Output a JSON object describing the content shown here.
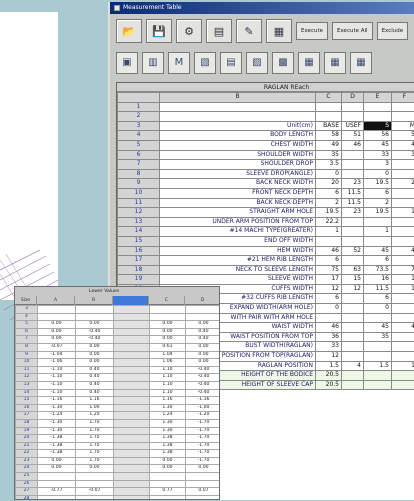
{
  "window": {
    "title": "Measurement Table"
  },
  "toolbar": {
    "icons": [
      "open-icon",
      "save-icon",
      "tools-icon",
      "chart-icon",
      "edit-icon",
      "grid-icon"
    ],
    "buttons": [
      "Execute",
      "Execute All",
      "Exclude"
    ]
  },
  "toolbar2": {
    "icons": [
      "table-layout-icon",
      "columns-icon",
      "m-icon",
      "split-icon",
      "sheet-icon",
      "insert-col-icon",
      "insert-row-icon",
      "merge-icon",
      "merge-right-icon",
      "grid-end-icon"
    ],
    "m_label": "M"
  },
  "sheet": {
    "title": "RAGLAN REach",
    "columns": [
      "B",
      "C",
      "D",
      "E",
      "F"
    ],
    "units_row": {
      "label": "Unit(cm)",
      "values": [
        "BASE",
        "USEF",
        "S",
        "M"
      ]
    },
    "rows": [
      {
        "n": "1",
        "label": "",
        "values": [
          "",
          "",
          "",
          ""
        ]
      },
      {
        "n": "2",
        "label": "",
        "values": [
          "",
          "",
          "",
          ""
        ]
      },
      {
        "n": "3",
        "label": "Unit(cm)",
        "values": [
          "BASE",
          "USEF",
          "S",
          "M"
        ],
        "units": true
      },
      {
        "n": "4",
        "label": "BODY LENGTH",
        "values": [
          "58",
          "51",
          "56",
          "5"
        ]
      },
      {
        "n": "5",
        "label": "CHEST WIDTH",
        "values": [
          "49",
          "46",
          "45",
          "4"
        ]
      },
      {
        "n": "6",
        "label": "SHOULDER WIDTH",
        "values": [
          "35",
          "",
          "33",
          "3"
        ]
      },
      {
        "n": "7",
        "label": "SHOULDER DROP",
        "values": [
          "3.5",
          "",
          "3",
          ""
        ]
      },
      {
        "n": "8",
        "label": "SLEEVE DROP(ANGLE)",
        "values": [
          "0",
          "",
          "0",
          ""
        ]
      },
      {
        "n": "9",
        "label": "BACK NECK WIDTH",
        "values": [
          "20",
          "23",
          "19.5",
          "2"
        ]
      },
      {
        "n": "10",
        "label": "FRONT NECK DEPTH",
        "values": [
          "6",
          "11.5",
          "6",
          ""
        ]
      },
      {
        "n": "11",
        "label": "BACK NECK DEPTH",
        "values": [
          "2",
          "11.5",
          "2",
          ""
        ]
      },
      {
        "n": "12",
        "label": "STRAIGHT ARM HOLE",
        "values": [
          "19.5",
          "23",
          "19.5",
          "1"
        ]
      },
      {
        "n": "13",
        "label": "UNDER ARM POSITION FROM TOP",
        "values": [
          "22.2",
          "",
          "",
          ""
        ]
      },
      {
        "n": "14",
        "label": "#14 MACHI TYPE(GREATER)",
        "values": [
          "1",
          "",
          "1",
          ""
        ]
      },
      {
        "n": "15",
        "label": "END OFF WIDTH",
        "values": [
          "",
          "",
          "",
          ""
        ]
      },
      {
        "n": "16",
        "label": "HEM WIDTH",
        "values": [
          "46",
          "52",
          "45",
          "4"
        ]
      },
      {
        "n": "17",
        "label": "#21 HEM RIB LENGTH",
        "values": [
          "6",
          "",
          "6",
          ""
        ]
      },
      {
        "n": "18",
        "label": "NECK TO SLEEVE LENGTH",
        "values": [
          "75",
          "63",
          "73.5",
          "7"
        ]
      },
      {
        "n": "19",
        "label": "SLEEVE WIDTH",
        "values": [
          "17",
          "15",
          "16",
          "1"
        ]
      },
      {
        "n": "20",
        "label": "CUFFS WIDTH",
        "values": [
          "12",
          "12",
          "11.5",
          "1"
        ]
      },
      {
        "n": "21",
        "label": "#32 CUFFS RIB LENGTH",
        "values": [
          "6",
          "",
          "6",
          ""
        ]
      },
      {
        "n": "22",
        "label": "EXPAND WIDTH(ARM HOLE)",
        "values": [
          "0",
          "",
          "0",
          ""
        ]
      },
      {
        "n": "23",
        "label": "WITH PAIR WITH ARM HOLE",
        "values": [
          "",
          "",
          "",
          ""
        ]
      },
      {
        "n": "24",
        "label": "WAIST WIDTH",
        "values": [
          "46",
          "",
          "45",
          "4"
        ]
      },
      {
        "n": "25",
        "label": "WAIST POSITION FROM TOP",
        "values": [
          "36",
          "",
          "35",
          ""
        ]
      },
      {
        "n": "26",
        "label": "BUST WIDTH(RAGLAN)",
        "values": [
          "33",
          "",
          "",
          ""
        ]
      },
      {
        "n": "27",
        "label": "POSITION FROM TOP(RAGLAN)",
        "values": [
          "12",
          "",
          "",
          ""
        ]
      },
      {
        "n": "28",
        "label": "RAGLAN POSITION",
        "values": [
          "1.5",
          "4",
          "1.5",
          "1"
        ]
      },
      {
        "n": "29",
        "label": "HEIGHT OF THE BODICE",
        "values": [
          "20.5",
          "",
          "",
          ""
        ],
        "highlight": true
      },
      {
        "n": "30",
        "label": "HEIGHT OF SLEEVE CAP",
        "values": [
          "20.5",
          "",
          "",
          ""
        ],
        "highlight": true
      }
    ]
  },
  "small_sheet": {
    "title": "Lower Values",
    "col_headers": [
      "Size",
      "A",
      "B",
      "",
      "C",
      "D"
    ],
    "rows": [
      {
        "n": "3",
        "v": [
          "",
          "",
          "",
          "",
          ""
        ]
      },
      {
        "n": "4",
        "v": [
          "",
          "",
          "",
          "",
          ""
        ]
      },
      {
        "n": "5",
        "v": [
          "0.00",
          "0.00",
          "",
          "0.00",
          "0.00"
        ]
      },
      {
        "n": "6",
        "v": [
          "0.00",
          "-0.40",
          "",
          "0.00",
          "0.40"
        ]
      },
      {
        "n": "7",
        "v": [
          "0.00",
          "-0.40",
          "",
          "0.00",
          "0.40"
        ]
      },
      {
        "n": "8",
        "v": [
          "-0.07",
          "0.00",
          "",
          "0.61",
          "0.00"
        ]
      },
      {
        "n": "9",
        "v": [
          "-1.04",
          "0.00",
          "",
          "1.04",
          "0.00"
        ]
      },
      {
        "n": "10",
        "v": [
          "-1.06",
          "0.00",
          "",
          "1.06",
          "0.00"
        ]
      },
      {
        "n": "11",
        "v": [
          "-1.10",
          "0.40",
          "",
          "1.10",
          "-0.40"
        ]
      },
      {
        "n": "12",
        "v": [
          "-1.10",
          "0.40",
          "",
          "1.10",
          "-0.40"
        ]
      },
      {
        "n": "13",
        "v": [
          "-1.10",
          "0.40",
          "",
          "1.10",
          "-0.40"
        ]
      },
      {
        "n": "14",
        "v": [
          "-1.10",
          "0.40",
          "",
          "1.10",
          "-0.40"
        ]
      },
      {
        "n": "15",
        "v": [
          "-1.16",
          "1.16",
          "",
          "1.16",
          "-1.16"
        ]
      },
      {
        "n": "16",
        "v": [
          "-1.30",
          "1.00",
          "",
          "1.30",
          "-1.00"
        ]
      },
      {
        "n": "17",
        "v": [
          "-1.24",
          "1.20",
          "",
          "1.24",
          "-1.20"
        ]
      },
      {
        "n": "18",
        "v": [
          "-1.30",
          "1.70",
          "",
          "1.30",
          "-1.70"
        ]
      },
      {
        "n": "19",
        "v": [
          "-1.30",
          "1.70",
          "",
          "1.30",
          "-1.70"
        ]
      },
      {
        "n": "20",
        "v": [
          "-1.38",
          "1.70",
          "",
          "1.38",
          "-1.70"
        ]
      },
      {
        "n": "21",
        "v": [
          "-1.38",
          "1.70",
          "",
          "1.38",
          "-1.70"
        ]
      },
      {
        "n": "22",
        "v": [
          "-1.38",
          "1.70",
          "",
          "1.38",
          "-1.70"
        ]
      },
      {
        "n": "23",
        "v": [
          "0.00",
          "1.70",
          "",
          "0.00",
          "-1.70"
        ]
      },
      {
        "n": "24",
        "v": [
          "0.00",
          "0.00",
          "",
          "0.00",
          "0.00"
        ]
      },
      {
        "n": "25",
        "v": [
          "",
          "",
          "",
          "",
          ""
        ]
      },
      {
        "n": "26",
        "v": [
          "",
          "",
          "",
          "",
          ""
        ]
      },
      {
        "n": "27",
        "v": [
          "-0.77",
          "-0.07",
          "",
          "0.77",
          "0.07"
        ]
      },
      {
        "n": "28",
        "v": [
          "",
          "",
          "",
          "",
          ""
        ]
      },
      {
        "n": "29",
        "v": [
          "0.00",
          "0.07",
          "",
          "0.00",
          "-0.07"
        ]
      }
    ]
  }
}
